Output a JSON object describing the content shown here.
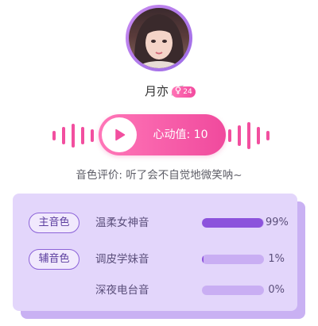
{
  "profile": {
    "name": "月亦",
    "age_badge": "24",
    "gender_icon": "female-icon",
    "wing_icon": "wing-icon"
  },
  "player": {
    "play_icon": "play-icon",
    "heart_value_label": "心动值: 10"
  },
  "evaluation": {
    "text": "音色评价: 听了会不自觉地微笑呐~"
  },
  "voice_results": [
    {
      "tag": "主音色",
      "name": "温柔女神音",
      "percent_label": "99%",
      "fraction": 0.99
    },
    {
      "tag": "辅音色",
      "name": "调皮学妹音",
      "percent_label": "1%",
      "fraction": 0.01
    },
    {
      "tag": "",
      "name": "深夜电台音",
      "percent_label": "0%",
      "fraction": 0.0
    }
  ],
  "colors": {
    "accent_pink": "#f24f9f",
    "accent_purple": "#8c53dc",
    "card_background": "#e3d6fb"
  }
}
